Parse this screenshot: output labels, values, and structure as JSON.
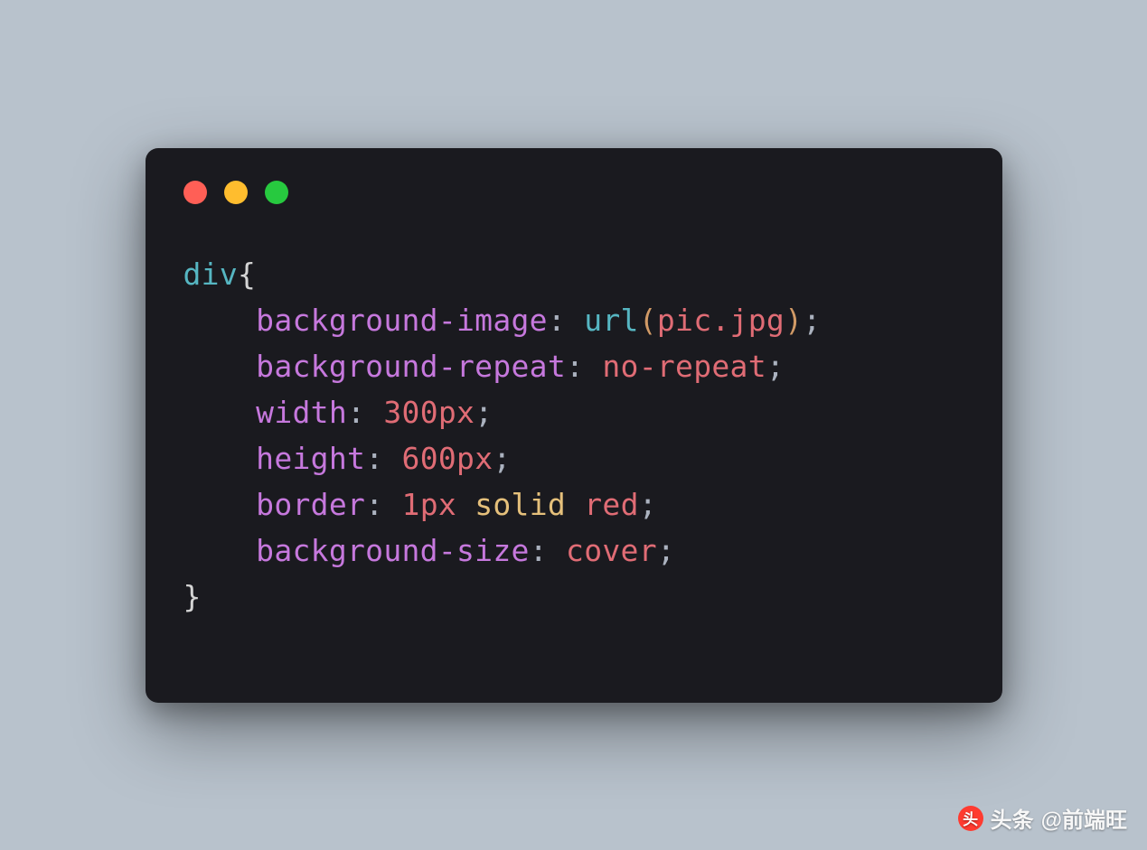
{
  "traffic_lights": {
    "red": "#ff5f56",
    "yellow": "#ffbd2e",
    "green": "#27c93f"
  },
  "code": {
    "selector": "div",
    "open_brace": "{",
    "close_brace": "}",
    "indent": "    ",
    "lines": [
      {
        "property": "background-image",
        "func": "url",
        "arg": "pic.jpg"
      },
      {
        "property": "background-repeat",
        "value": "no-repeat",
        "value_class": "tok-value-red"
      },
      {
        "property": "width",
        "number": "300",
        "unit": "px"
      },
      {
        "property": "height",
        "number": "600",
        "unit": "px"
      },
      {
        "property": "border",
        "parts": [
          {
            "text": "1px",
            "cls": "tok-number"
          },
          {
            "text": " ",
            "cls": "tok-colon"
          },
          {
            "text": "solid",
            "cls": "tok-ident"
          },
          {
            "text": " ",
            "cls": "tok-colon"
          },
          {
            "text": "red",
            "cls": "tok-value-red"
          }
        ]
      },
      {
        "property": "background-size",
        "value": "cover",
        "value_class": "tok-value-red"
      }
    ],
    "colon": ":",
    "semi": ";",
    "paren_open": "(",
    "paren_close": ")"
  },
  "watermark": {
    "label": "头条",
    "handle": "@前端旺",
    "icon_glyph": "头"
  }
}
